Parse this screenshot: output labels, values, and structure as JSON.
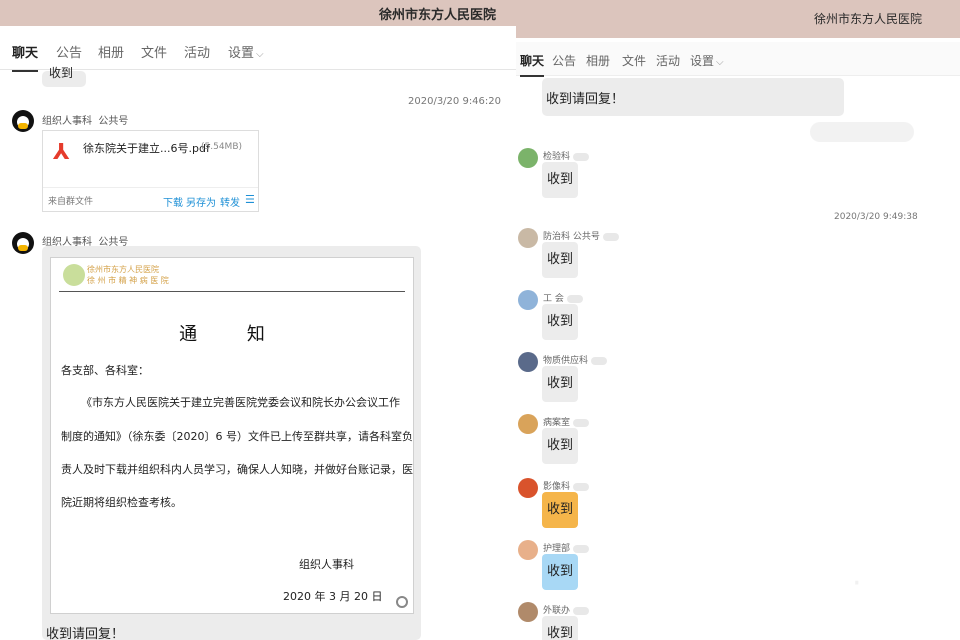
{
  "left": {
    "window_title": "徐州市东方人民医院",
    "tabs": [
      "聊天",
      "公告",
      "相册",
      "文件",
      "活动",
      "设置"
    ],
    "top_bubble": "收到",
    "timestamp": "2020/3/20 9:46:20",
    "msg1": {
      "sender": "组织人事科",
      "tag": "公共号",
      "file": {
        "name": "徐东院关于建立...6号.pdf",
        "size": "(5.54MB)",
        "source": "来自群文件",
        "actions": [
          "下载",
          "另存为",
          "转发"
        ]
      }
    },
    "msg2": {
      "sender": "组织人事科",
      "tag": "公共号"
    },
    "doc": {
      "logo_line1": "徐州市东方人民医院",
      "logo_line2": "徐 州 市 精 神 病 医 院",
      "title": "通 知",
      "greeting": "各支部、各科室：",
      "body": [
        "《市东方人民医院关于建立完善医院党委会议和院长办公会议工作",
        "制度的通知》（徐东委〔2020〕6 号）文件已上传至群共享，请各科室负",
        "责人及时下载并组织科内人员学习，确保人人知晓，并做好台账记录，医",
        "院近期将组织检查考核。"
      ],
      "signature": "组织人事科",
      "date": "2020 年 3 月 20 日"
    },
    "bottom_text": "收到请回复！"
  },
  "right": {
    "window_title": "徐州市东方人民医院",
    "tabs": [
      "聊天",
      "公告",
      "相册",
      "文件",
      "活动",
      "设置"
    ],
    "top_bubble": "收到请回复！",
    "timestamp": "2020/3/20 9:49:38",
    "replies": [
      {
        "sender": "检验科",
        "text": "收到",
        "avatar_color": "#7bb36a"
      },
      {
        "sender": "防治科 公共号",
        "text": "收到",
        "avatar_color": "#c9b9a5"
      },
      {
        "sender": "工 会",
        "text": "收到",
        "avatar_color": "#8fb3d9"
      },
      {
        "sender": "物质供应科",
        "text": "收到",
        "avatar_color": "#5a6a8a"
      },
      {
        "sender": "病案室",
        "text": "收到",
        "avatar_color": "#d9a35a"
      },
      {
        "sender": "影像科",
        "text": "收到",
        "avatar_color": "#d9532c"
      },
      {
        "sender": "护理部",
        "text": "收到",
        "avatar_color": "#e8b08a"
      },
      {
        "sender": "外联办",
        "text": "收到",
        "avatar_color": "#b08a6a"
      }
    ]
  },
  "colors": {
    "titlebar": "#dcc5bd",
    "link": "#1e90d6",
    "bubble": "#ececec",
    "highlight_bubble": "#f5b54a",
    "blue_bubble": "#a8d8f5"
  }
}
